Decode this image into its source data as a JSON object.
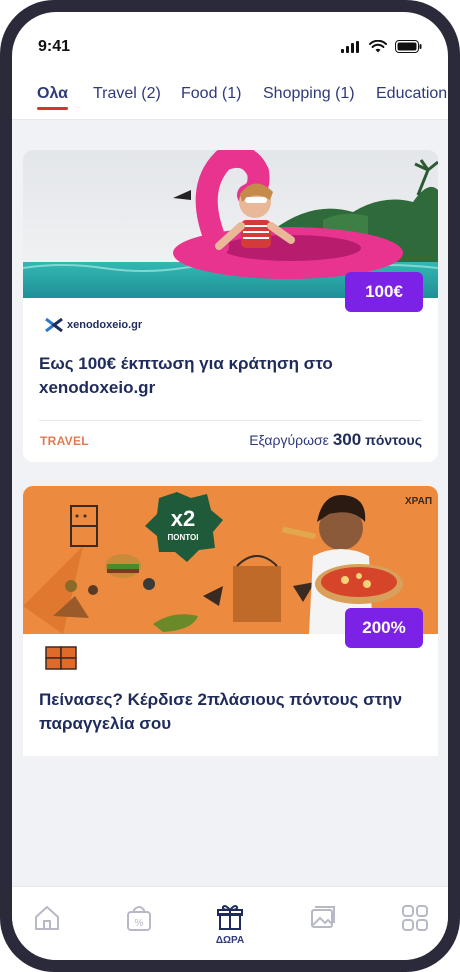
{
  "status_bar": {
    "time": "9:41"
  },
  "tabs": [
    {
      "label": "Ολα",
      "active": true
    },
    {
      "label": "Travel (2)"
    },
    {
      "label": "Food (1)"
    },
    {
      "label": "Shopping (1)"
    },
    {
      "label": "Education"
    }
  ],
  "offers": [
    {
      "badge": "100€",
      "brand": "xenodoxeio.gr",
      "title": "Εως 100€ έκπτωση για κράτηση στο xenodoxeio.gr",
      "category": "TRAVEL",
      "points_prefix": "Εξαργύρωσε",
      "points_value": "300",
      "points_unit": "πόντους"
    },
    {
      "badge": "200%",
      "promo_text": "x2",
      "promo_sub": "ΠΟΝΤΟΙ",
      "title": "Πείνασες? Κέρδισε 2πλάσιους πόντους στην παραγγελία σου"
    }
  ],
  "bottom_nav": {
    "items": [
      {
        "icon": "home-icon"
      },
      {
        "icon": "discount-bag-icon"
      },
      {
        "icon": "gift-icon",
        "label": "ΔΩΡΑ",
        "active": true
      },
      {
        "icon": "gallery-icon"
      },
      {
        "icon": "grid-icon"
      }
    ]
  },
  "colors": {
    "accent": "#7c22e6",
    "navy": "#1f2b5b",
    "tab_underline": "#d8342c",
    "category": "#e07a55"
  }
}
